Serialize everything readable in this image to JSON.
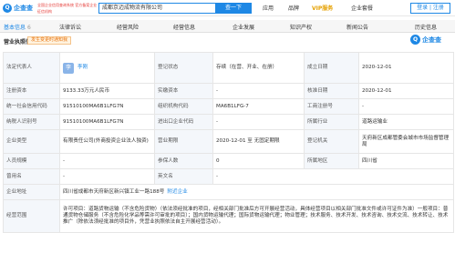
{
  "header": {
    "logo_text": "企查查",
    "badge_text": "全国企业信用查询系统 官方备案企业征信机构",
    "search_value": "成都京迈成物流有限公司",
    "search_button": "查一下",
    "nav": [
      "应用",
      "品牌",
      "VIP服务",
      "企业套餐"
    ],
    "login": "登录 | 注册"
  },
  "tabs": [
    {
      "label": "基本信息",
      "count": "6"
    },
    {
      "label": "法律诉讼",
      "count": ""
    },
    {
      "label": "经营风险",
      "count": ""
    },
    {
      "label": "经营信息",
      "count": ""
    },
    {
      "label": "企业发展",
      "count": ""
    },
    {
      "label": "知识产权",
      "count": ""
    },
    {
      "label": "新闻公告",
      "count": ""
    },
    {
      "label": "历史信息",
      "count": ""
    }
  ],
  "section": {
    "title": "营业执照信息",
    "change_badge": "发生变更时通知我",
    "watermark": "企查查"
  },
  "info": {
    "legal_rep_label": "法定代表人",
    "legal_rep_avatar": "李",
    "legal_rep_name": "李刚",
    "status_label": "登记状态",
    "status_value": "存续（在营、开业、在册）",
    "found_label": "成立日期",
    "found_value": "2020-12-01",
    "reg_cap_label": "注册资本",
    "reg_cap_value": "9133.33万元人民币",
    "paid_cap_label": "实缴资本",
    "paid_cap_value": "-",
    "approve_label": "核准日期",
    "approve_value": "2020-12-01",
    "credit_code_label": "统一社会信用代码",
    "credit_code_value": "91510100MA6B1LFG7N",
    "org_code_label": "组织机构代码",
    "org_code_value": "MA6B1LFG-7",
    "biz_reg_label": "工商注册号",
    "biz_reg_value": "-",
    "tax_id_label": "纳税人识别号",
    "tax_id_value": "91510100MA6B1LFG7N",
    "import_label": "进出口企业代码",
    "import_value": "-",
    "industry_label": "所属行业",
    "industry_value": "道路运输业",
    "type_label": "企业类型",
    "type_value": "有限责任公司(外商投资企业法人独资)",
    "term_label": "营业期限",
    "term_value": "2020-12-01 至 无固定期限",
    "authority_label": "登记机关",
    "authority_value": "天府新区成都管委会城市市场监督管理局",
    "staff_label": "人员规模",
    "staff_value": "-",
    "insured_label": "参保人数",
    "insured_value": "0",
    "region_label": "所属地区",
    "region_value": "四川省",
    "former_label": "曾用名",
    "former_value": "-",
    "english_label": "英文名",
    "english_value": "-",
    "address_label": "企业地址",
    "address_value": "四川省成都市天府新区新兴镇工业一路188号",
    "address_link": "附近企业",
    "scope_label": "经营范围",
    "scope_value": "许可项目：道路货物运输（不含危险货物）（依法须经批准的项目，经相关部门批准后方可开展经营活动，具体经营项目以相关部门批准文件或许可证件为准）一般项目：普通货物仓储服务（不含危险化学品等需许可审批的项目）；国内货物运输代理；国际货物运输代理；物业管理；技术服务、技术开发、技术咨询、技术交流、技术转让、技术推广（除依法须经批准的项目外，凭营业执照依法自主开展经营活动）。"
  }
}
